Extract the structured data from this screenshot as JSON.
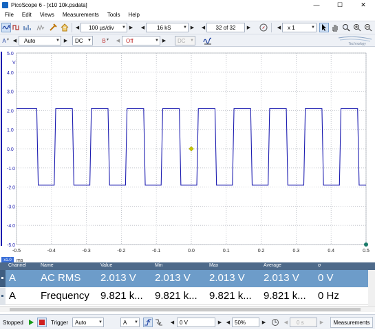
{
  "window": {
    "title": "PicoScope 6 - [x10 10k.psdata]",
    "minimize": "—",
    "maximize": "☐",
    "close": "✕"
  },
  "menu": [
    "File",
    "Edit",
    "Views",
    "Measurements",
    "Tools",
    "Help"
  ],
  "toolbar": {
    "timebase": "100 µs/div",
    "samples": "16 kS",
    "buffer": "32 of 32",
    "zoom": "x 1"
  },
  "channel_bar": {
    "ch_a_label": "A",
    "ch_a_range": "Auto",
    "ch_a_coupling": "DC",
    "ch_b_label": "B",
    "ch_b_range": "Off",
    "ch_b_coupling": "DC",
    "logo_text": "Technology"
  },
  "scope": {
    "y_unit": "V",
    "y_ticks": [
      "5.0",
      "4.0",
      "3.0",
      "2.0",
      "1.0",
      "0.0",
      "-1.0",
      "-2.0",
      "-3.0",
      "-4.0",
      "-5.0"
    ],
    "x_unit": "ms",
    "x_ticks": [
      "-0.5",
      "-0.4",
      "-0.3",
      "-0.2",
      "-0.1",
      "0.0",
      "0.1",
      "0.2",
      "0.3",
      "0.4",
      "0.5"
    ],
    "x_unit_marker": "x1.0",
    "trace_color": "#1c1cb0",
    "trigger_color": "#c8c800"
  },
  "chart_data": {
    "type": "line",
    "x_range_ms": [
      -0.5,
      0.5
    ],
    "ylim": [
      -5.0,
      5.0
    ],
    "ylabel": "V",
    "xlabel": "ms",
    "series": [
      {
        "name": "A",
        "waveform": "square",
        "high_v": 2.1,
        "low_v": -1.9,
        "period_ms": 0.1018,
        "rising_edges_ms": [
          -0.39,
          -0.288,
          -0.186,
          -0.084,
          0.018,
          0.12,
          0.222,
          0.324,
          0.426
        ],
        "falling_edges_ms": [
          -0.44,
          -0.338,
          -0.236,
          -0.134,
          -0.032,
          0.07,
          0.172,
          0.274,
          0.376,
          0.478
        ]
      }
    ],
    "trigger": {
      "x_ms": 0.0,
      "y_v": 0.0
    }
  },
  "measurements": {
    "headers": [
      "Channel",
      "Name",
      "Value",
      "Min",
      "Max",
      "Average",
      "σ"
    ],
    "rows": [
      {
        "channel": "A",
        "name": "AC RMS",
        "value": "2.013 V",
        "min": "2.013 V",
        "max": "2.013 V",
        "average": "2.013 V",
        "sigma": "0 V"
      },
      {
        "channel": "A",
        "name": "Frequency",
        "value": "9.821 k...",
        "min": "9.821 k...",
        "max": "9.821 k...",
        "average": "9.821 k...",
        "sigma": "0 Hz"
      }
    ]
  },
  "status": {
    "state": "Stopped",
    "trigger_label": "Trigger",
    "trigger_mode": "Auto",
    "trigger_channel": "A",
    "threshold": "0 V",
    "pretrigger": "50%",
    "delay": "0 s",
    "measurements_button": "Measurements"
  }
}
